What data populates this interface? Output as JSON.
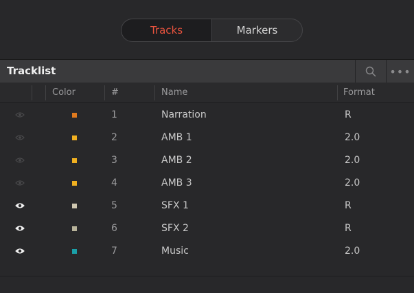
{
  "segmented": {
    "tabs": [
      {
        "label": "Tracks",
        "active": true
      },
      {
        "label": "Markers",
        "active": false
      }
    ]
  },
  "tracklist": {
    "title": "Tracklist",
    "search_icon": "search-icon",
    "more_icon": "more-options-icon",
    "more_glyph": "•••"
  },
  "columns": {
    "color": "Color",
    "number": "#",
    "name": "Name",
    "format": "Format"
  },
  "rows": [
    {
      "visible": false,
      "color": "#e07a1e",
      "number": "1",
      "name": "Narration",
      "format": "R"
    },
    {
      "visible": false,
      "color": "#f0b020",
      "number": "2",
      "name": "AMB 1",
      "format": "2.0"
    },
    {
      "visible": false,
      "color": "#f0b020",
      "number": "3",
      "name": "AMB 2",
      "format": "2.0"
    },
    {
      "visible": false,
      "color": "#f0b020",
      "number": "4",
      "name": "AMB 3",
      "format": "2.0"
    },
    {
      "visible": true,
      "color": "#cfc7b0",
      "number": "5",
      "name": "SFX 1",
      "format": "R"
    },
    {
      "visible": true,
      "color": "#b8b39a",
      "number": "6",
      "name": "SFX 2",
      "format": "R"
    },
    {
      "visible": true,
      "color": "#1aa0a8",
      "number": "7",
      "name": "Music",
      "format": "2.0"
    }
  ],
  "colors": {
    "accent": "#e8533e",
    "eye_on": "#f2f2f2",
    "eye_off": "#4a4a4c"
  }
}
